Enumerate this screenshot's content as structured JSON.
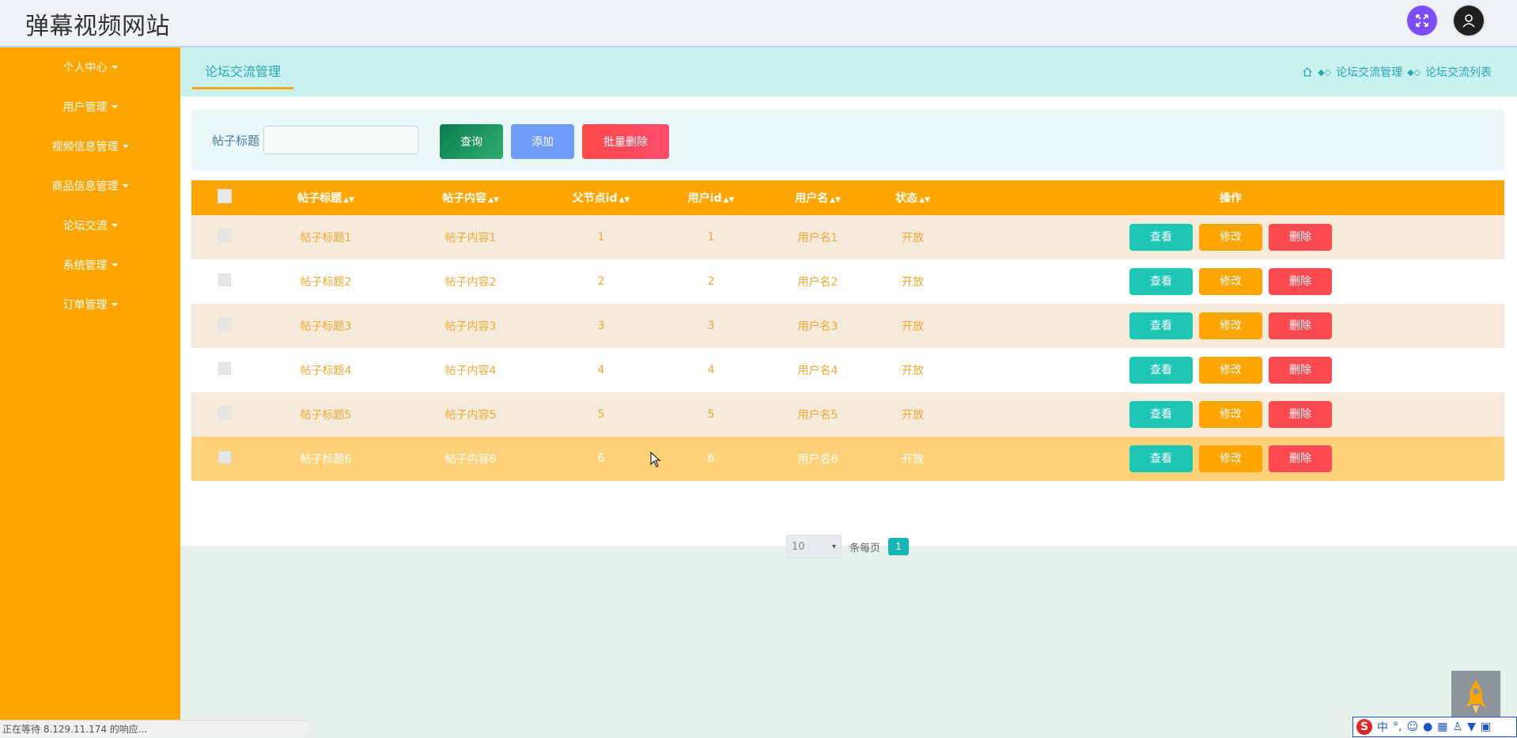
{
  "header": {
    "site_title": "弹幕视频网站"
  },
  "sidebar": {
    "items": [
      {
        "label": "个人中心"
      },
      {
        "label": "用户管理"
      },
      {
        "label": "视频信息管理"
      },
      {
        "label": "商品信息管理"
      },
      {
        "label": "论坛交流"
      },
      {
        "label": "系统管理"
      },
      {
        "label": "订单管理"
      }
    ]
  },
  "tabbar": {
    "active_tab": "论坛交流管理",
    "breadcrumb": [
      "论坛交流管理",
      "论坛交流列表"
    ]
  },
  "search": {
    "label": "帖子标题",
    "value": "",
    "query_label": "查询",
    "add_label": "添加",
    "batch_delete_label": "批量删除"
  },
  "table": {
    "columns": [
      "帖子标题",
      "帖子内容",
      "父节点id",
      "用户id",
      "用户名",
      "状态",
      "操作"
    ],
    "rows": [
      {
        "title": "帖子标题1",
        "content": "帖子内容1",
        "parent_id": "1",
        "user_id": "1",
        "username": "用户名1",
        "status": "开放"
      },
      {
        "title": "帖子标题2",
        "content": "帖子内容2",
        "parent_id": "2",
        "user_id": "2",
        "username": "用户名2",
        "status": "开放"
      },
      {
        "title": "帖子标题3",
        "content": "帖子内容3",
        "parent_id": "3",
        "user_id": "3",
        "username": "用户名3",
        "status": "开放"
      },
      {
        "title": "帖子标题4",
        "content": "帖子内容4",
        "parent_id": "4",
        "user_id": "4",
        "username": "用户名4",
        "status": "开放"
      },
      {
        "title": "帖子标题5",
        "content": "帖子内容5",
        "parent_id": "5",
        "user_id": "5",
        "username": "用户名5",
        "status": "开放"
      },
      {
        "title": "帖子标题6",
        "content": "帖子内容6",
        "parent_id": "6",
        "user_id": "6",
        "username": "用户名6",
        "status": "开放"
      }
    ],
    "actions": {
      "view": "查看",
      "edit": "修改",
      "delete": "删除"
    }
  },
  "pagination": {
    "page_size": "10",
    "per_page_label": "条每页",
    "current_page": "1"
  },
  "status_bar": {
    "text": "正在等待 8.129.11.174 的响应..."
  },
  "ime": {
    "logo": "S",
    "mode": "中"
  },
  "colors": {
    "sidebar": "#ffa500",
    "accent": "#2aa7b2",
    "view": "#1ec6b4",
    "edit": "#ffa500",
    "delete": "#ff4a52"
  }
}
